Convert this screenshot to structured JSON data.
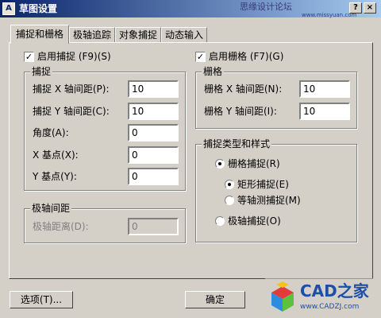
{
  "window": {
    "title": "草图设置",
    "watermark": "思缘设计论坛",
    "watermark_url": "www.missyuan.com"
  },
  "title_buttons": {
    "help": "?",
    "close": "×"
  },
  "tabs": [
    {
      "label": "捕捉和栅格",
      "active": true
    },
    {
      "label": "极轴追踪",
      "active": false
    },
    {
      "label": "对象捕捉",
      "active": false
    },
    {
      "label": "动态输入",
      "active": false
    }
  ],
  "snap": {
    "enable_label": "启用捕捉 (F9)(S)",
    "enabled": true,
    "group_label": "捕捉",
    "x_spacing_label": "捕捉 X 轴间距(P):",
    "x_spacing_value": "10",
    "y_spacing_label": "捕捉 Y 轴间距(C):",
    "y_spacing_value": "10",
    "angle_label": "角度(A):",
    "angle_value": "0",
    "x_base_label": "X 基点(X):",
    "x_base_value": "0",
    "y_base_label": "Y 基点(Y):",
    "y_base_value": "0"
  },
  "polar": {
    "group_label": "极轴间距",
    "distance_label": "极轴距离(D):",
    "distance_value": "0"
  },
  "grid": {
    "enable_label": "启用栅格 (F7)(G)",
    "enabled": true,
    "group_label": "栅格",
    "x_spacing_label": "栅格 X 轴间距(N):",
    "x_spacing_value": "10",
    "y_spacing_label": "栅格 Y 轴间距(I):",
    "y_spacing_value": "10"
  },
  "snap_type": {
    "group_label": "捕捉类型和样式",
    "grid_snap_label": "栅格捕捉(R)",
    "rectangular_label": "矩形捕捉(E)",
    "isometric_label": "等轴测捕捉(M)",
    "polar_snap_label": "极轴捕捉(O)",
    "selected_type": "grid",
    "selected_style": "rectangular"
  },
  "buttons": {
    "options": "选项(T)...",
    "ok": "确定"
  },
  "logo": {
    "brand": "CAD之家",
    "url": "www.CADZJ.com"
  }
}
